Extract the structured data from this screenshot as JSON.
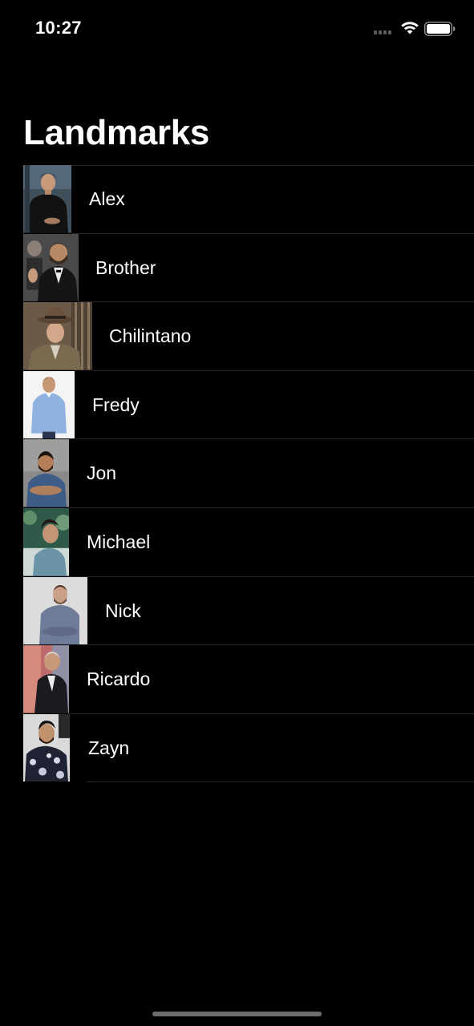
{
  "status_bar": {
    "time": "10:27",
    "signal_icon": "cellular-signal-icon",
    "wifi_icon": "wifi-icon",
    "battery_icon": "battery-icon"
  },
  "nav": {
    "title": "Landmarks"
  },
  "list": {
    "items": [
      {
        "name": "Alex"
      },
      {
        "name": "Brother"
      },
      {
        "name": "Chilintano"
      },
      {
        "name": "Fredy"
      },
      {
        "name": "Jon"
      },
      {
        "name": "Michael"
      },
      {
        "name": "Nick"
      },
      {
        "name": "Ricardo"
      },
      {
        "name": "Zayn"
      }
    ]
  },
  "colors": {
    "background": "#000000",
    "separator": "#2a2a2c",
    "text": "#ffffff"
  }
}
